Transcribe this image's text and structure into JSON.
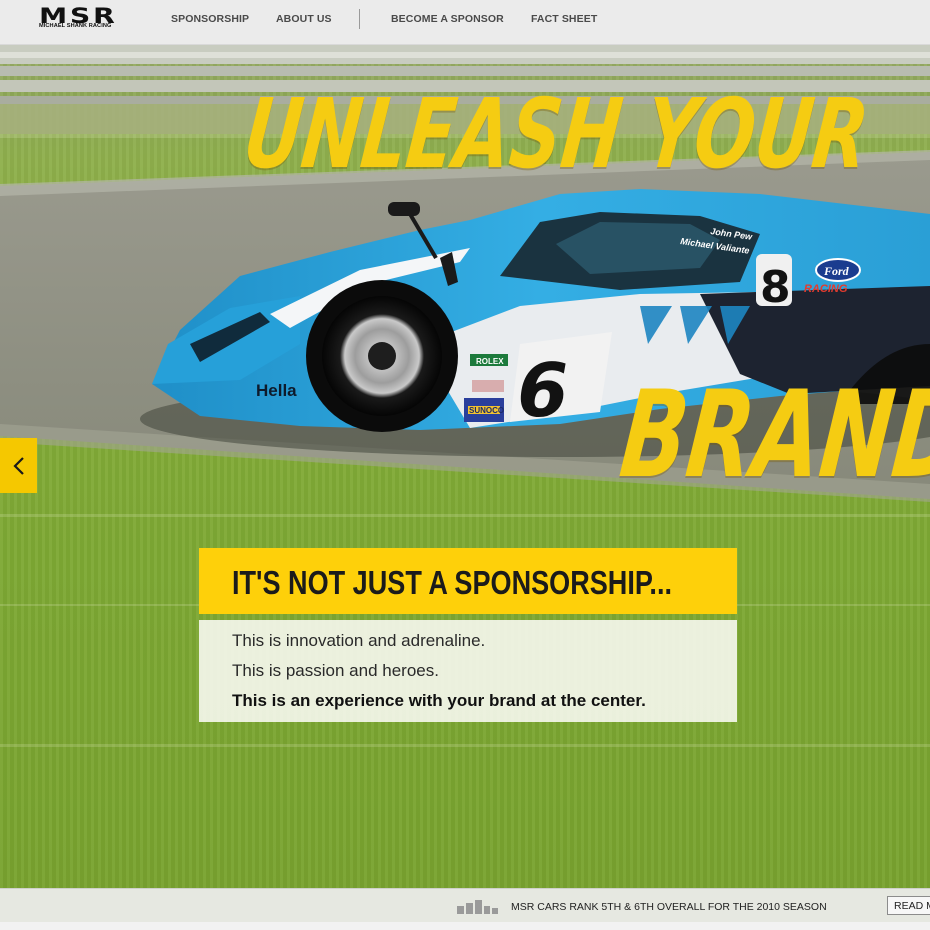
{
  "header": {
    "logo": {
      "mark": "MSR",
      "subtitle": "MICHAEL SHANK RACING"
    },
    "nav": [
      {
        "label": "SPONSORSHIP"
      },
      {
        "label": "ABOUT US"
      },
      {
        "label": "BECOME A SPONSOR"
      },
      {
        "label": "FACT SHEET"
      }
    ]
  },
  "hero": {
    "headline_top": "UNLEASH YOUR",
    "headline_bottom": "BRAND",
    "car": {
      "number": "6",
      "roof_number": "8",
      "sponsor_text": "Hella",
      "brand_badge": "Ford",
      "brand_sub": "RACING",
      "driver_names": [
        "John Pew",
        "Michael Valiante"
      ],
      "decals": [
        "ROLEX",
        "SUNOCO"
      ]
    },
    "tagline": "IT'S NOT JUST A SPONSORSHIP...",
    "copy": [
      "This is innovation and adrenaline.",
      "This is passion and heroes.",
      "This is an experience with your brand at the center."
    ],
    "prev_icon": "chevron-left-icon"
  },
  "ticker": {
    "icon": "bar-chart-icon",
    "text": "MSR CARS RANK 5TH & 6TH OVERALL FOR THE 2010 SEASON",
    "read_more_label": "READ MORE"
  },
  "colors": {
    "accent_yellow": "#fed00a",
    "car_blue": "#2fa6de",
    "grass_green": "#82ab38",
    "track_gray": "#8f9082"
  }
}
